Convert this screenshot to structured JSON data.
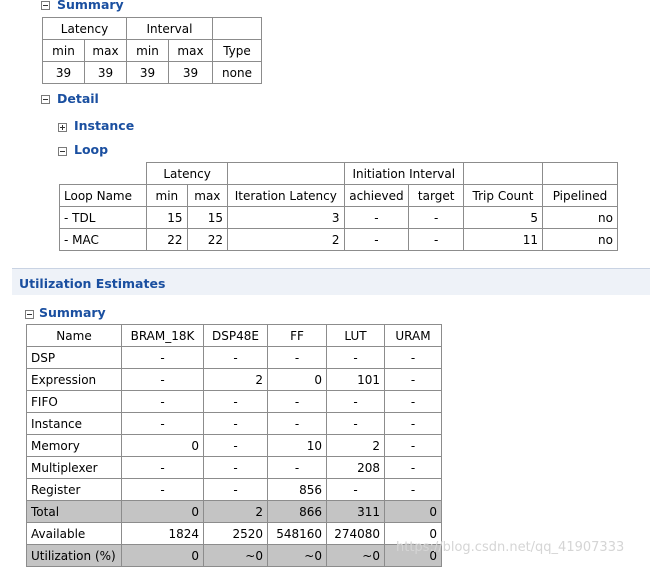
{
  "perf": {
    "summary_title": "Summary",
    "summary_table": {
      "group_headers": [
        "Latency",
        "Interval"
      ],
      "sub_headers": [
        "min",
        "max",
        "min",
        "max",
        "Type"
      ],
      "values": [
        "39",
        "39",
        "39",
        "39",
        "none"
      ]
    },
    "detail_title": "Detail",
    "instance_title": "Instance",
    "loop_title": "Loop",
    "loop_table": {
      "group_headers": [
        "Latency",
        "Initiation Interval"
      ],
      "sub_headers": [
        "Loop Name",
        "min",
        "max",
        "Iteration Latency",
        "achieved",
        "target",
        "Trip Count",
        "Pipelined"
      ],
      "rows": [
        [
          "- TDL",
          "15",
          "15",
          "3",
          "-",
          "-",
          "5",
          "no"
        ],
        [
          "- MAC",
          "22",
          "22",
          "2",
          "-",
          "-",
          "11",
          "no"
        ]
      ]
    }
  },
  "util": {
    "section_title": "Utilization Estimates",
    "summary_title": "Summary",
    "headers": [
      "Name",
      "BRAM_18K",
      "DSP48E",
      "FF",
      "LUT",
      "URAM"
    ],
    "rows": [
      [
        "DSP",
        "-",
        "-",
        "-",
        "-",
        "-"
      ],
      [
        "Expression",
        "-",
        "2",
        "0",
        "101",
        "-"
      ],
      [
        "FIFO",
        "-",
        "-",
        "-",
        "-",
        "-"
      ],
      [
        "Instance",
        "-",
        "-",
        "-",
        "-",
        "-"
      ],
      [
        "Memory",
        "0",
        "-",
        "10",
        "2",
        "-"
      ],
      [
        "Multiplexer",
        "-",
        "-",
        "-",
        "208",
        "-"
      ],
      [
        "Register",
        "-",
        "-",
        "856",
        "-",
        "-"
      ],
      [
        "Total",
        "0",
        "2",
        "866",
        "311",
        "0"
      ],
      [
        "Available",
        "1824",
        "2520",
        "548160",
        "274080",
        "0"
      ],
      [
        "Utilization (%)",
        "0",
        "~0",
        "~0",
        "~0",
        "0"
      ]
    ]
  },
  "watermark": "https://blog.csdn.net/qq_41907333"
}
